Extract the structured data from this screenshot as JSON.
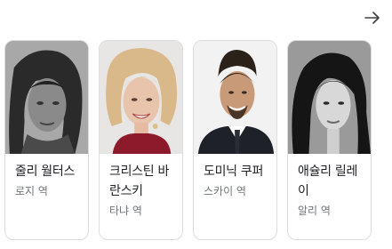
{
  "nav": {
    "next_icon": "arrow-right-icon"
  },
  "cast": [
    {
      "name": "줄리 월터스",
      "role": "로지 역"
    },
    {
      "name": "크리스틴 바란스키",
      "role": "타냐 역"
    },
    {
      "name": "도미닉 쿠퍼",
      "role": "스카이 역"
    },
    {
      "name": "애슐리 릴레이",
      "role": "알리 역"
    }
  ]
}
